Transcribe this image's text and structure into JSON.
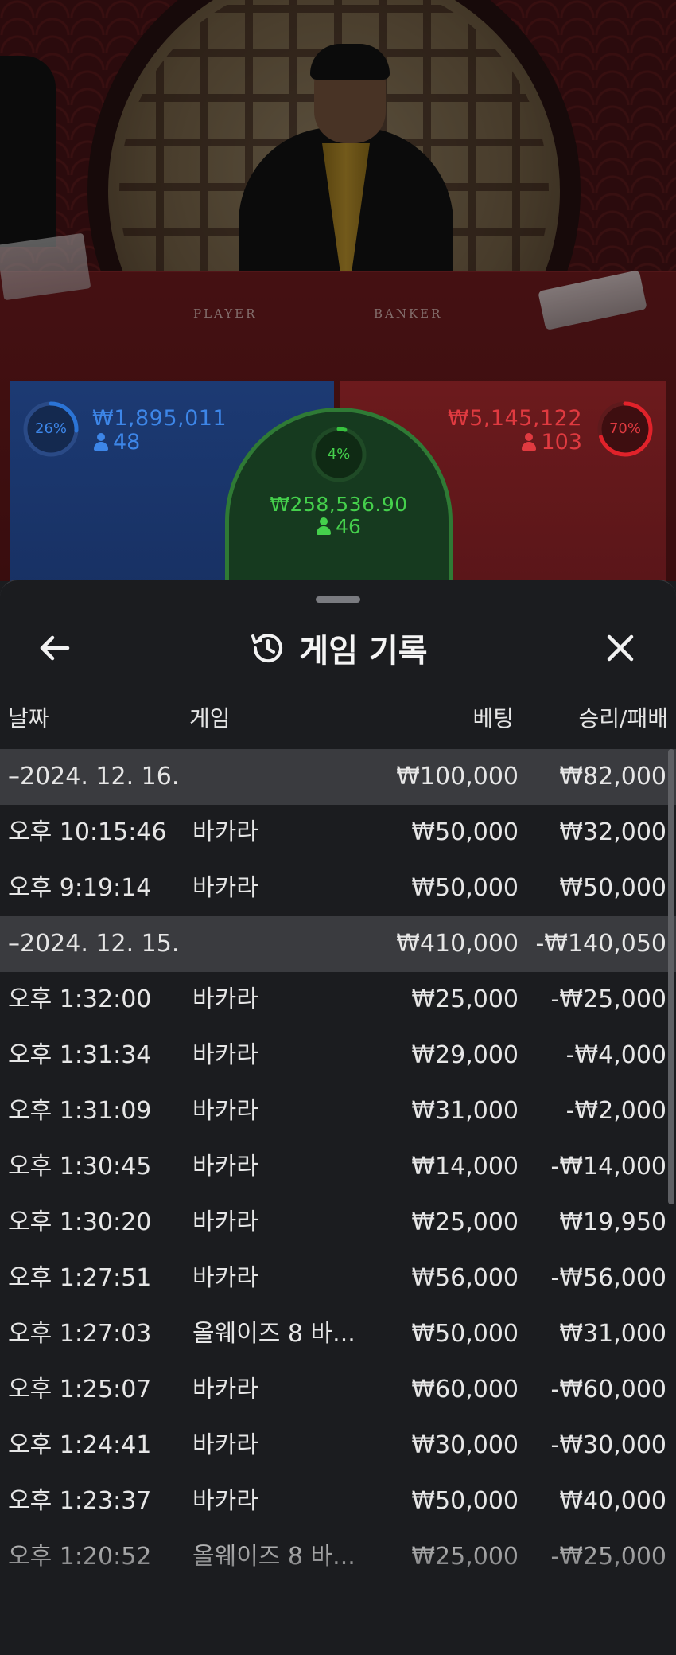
{
  "table": {
    "felt_player": "PLAYER",
    "felt_banker": "BANKER"
  },
  "bets": {
    "player": {
      "percent": "26%",
      "amount": "₩1,895,011",
      "players": "48",
      "percent_value": 0.26,
      "color": "#2b74d6"
    },
    "tie": {
      "percent": "4%",
      "amount": "₩258,536.90",
      "players": "46",
      "percent_value": 0.04,
      "color": "#37c23e"
    },
    "banker": {
      "percent": "70%",
      "amount": "₩5,145,122",
      "players": "103",
      "percent_value": 0.7,
      "color": "#e0222a"
    }
  },
  "history": {
    "title": "게임 기록",
    "back_icon": "arrow-left-icon",
    "title_icon": "history-clock-icon",
    "close_icon": "close-icon",
    "columns": {
      "date": "날짜",
      "game": "게임",
      "bet": "베팅",
      "result": "승리/패배"
    },
    "rows": [
      {
        "type": "date",
        "time": "–2024. 12. 16.",
        "game": "",
        "bet": "₩100,000",
        "result": "₩82,000"
      },
      {
        "type": "entry",
        "time": "오후 10:15:46",
        "game": "바카라",
        "bet": "₩50,000",
        "result": "₩32,000"
      },
      {
        "type": "entry",
        "time": "오후 9:19:14",
        "game": "바카라",
        "bet": "₩50,000",
        "result": "₩50,000"
      },
      {
        "type": "date",
        "time": "–2024. 12. 15.",
        "game": "",
        "bet": "₩410,000",
        "result": "-₩140,050"
      },
      {
        "type": "entry",
        "time": "오후 1:32:00",
        "game": "바카라",
        "bet": "₩25,000",
        "result": "-₩25,000"
      },
      {
        "type": "entry",
        "time": "오후 1:31:34",
        "game": "바카라",
        "bet": "₩29,000",
        "result": "-₩4,000"
      },
      {
        "type": "entry",
        "time": "오후 1:31:09",
        "game": "바카라",
        "bet": "₩31,000",
        "result": "-₩2,000"
      },
      {
        "type": "entry",
        "time": "오후 1:30:45",
        "game": "바카라",
        "bet": "₩14,000",
        "result": "-₩14,000"
      },
      {
        "type": "entry",
        "time": "오후 1:30:20",
        "game": "바카라",
        "bet": "₩25,000",
        "result": "₩19,950"
      },
      {
        "type": "entry",
        "time": "오후 1:27:51",
        "game": "바카라",
        "bet": "₩56,000",
        "result": "-₩56,000"
      },
      {
        "type": "entry",
        "time": "오후 1:27:03",
        "game": "올웨이즈 8 바...",
        "bet": "₩50,000",
        "result": "₩31,000"
      },
      {
        "type": "entry",
        "time": "오후 1:25:07",
        "game": "바카라",
        "bet": "₩60,000",
        "result": "-₩60,000"
      },
      {
        "type": "entry",
        "time": "오후 1:24:41",
        "game": "바카라",
        "bet": "₩30,000",
        "result": "-₩30,000"
      },
      {
        "type": "entry",
        "time": "오후 1:23:37",
        "game": "바카라",
        "bet": "₩50,000",
        "result": "₩40,000"
      },
      {
        "type": "entry",
        "time": "오후 1:20:52",
        "game": "올웨이즈 8 바...",
        "bet": "₩25,000",
        "result": "-₩25,000"
      }
    ]
  }
}
